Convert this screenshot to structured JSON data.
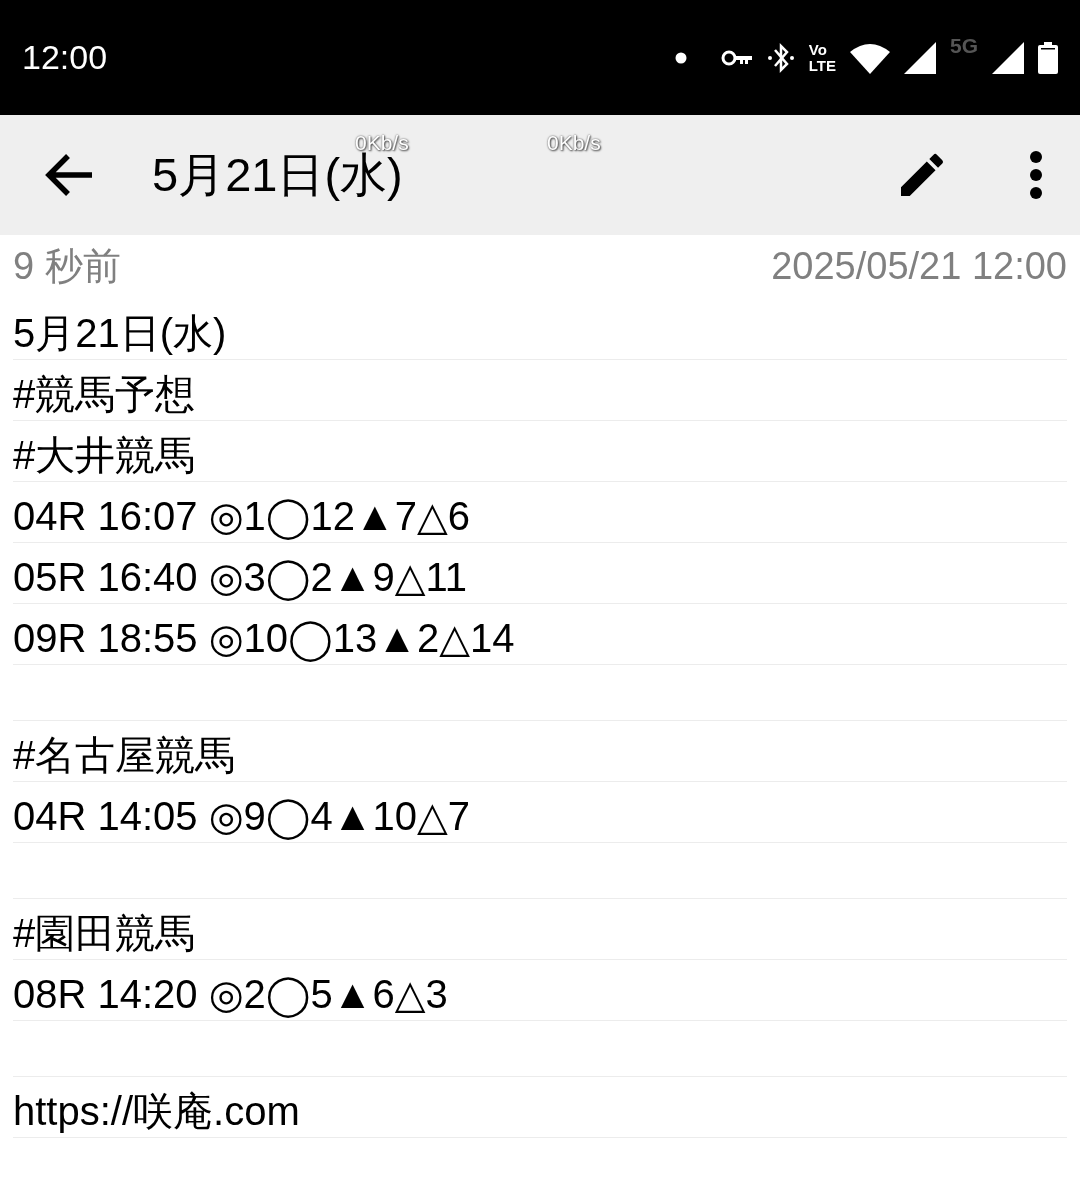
{
  "status_bar": {
    "time": "12:00",
    "volte_top": "Vo",
    "volte_bottom": "LTE",
    "network": "5G"
  },
  "app_bar": {
    "title": "5月21日(水)",
    "speed_left": "0Kb/s",
    "speed_right": "0Kb/s"
  },
  "meta": {
    "relative_time": "9 秒前",
    "timestamp": "2025/05/21 12:00"
  },
  "note_lines": [
    {
      "kind": "text",
      "text": "5月21日(水)"
    },
    {
      "kind": "text",
      "text": "#競馬予想"
    },
    {
      "kind": "text",
      "text": "#大井競馬"
    },
    {
      "kind": "text",
      "text": "04R 16:07 ◎1◯12▲7△6"
    },
    {
      "kind": "text",
      "text": "05R 16:40 ◎3◯2▲9△11"
    },
    {
      "kind": "text",
      "text": "09R 18:55 ◎10◯13▲2△14"
    },
    {
      "kind": "blank"
    },
    {
      "kind": "text",
      "text": "#名古屋競馬"
    },
    {
      "kind": "text",
      "text": "04R 14:05 ◎9◯4▲10△7"
    },
    {
      "kind": "blank"
    },
    {
      "kind": "text",
      "text": "#園田競馬"
    },
    {
      "kind": "text",
      "text": "08R 14:20 ◎2◯5▲6△3"
    },
    {
      "kind": "blank"
    },
    {
      "kind": "text",
      "text": "https://咲庵.com"
    }
  ]
}
